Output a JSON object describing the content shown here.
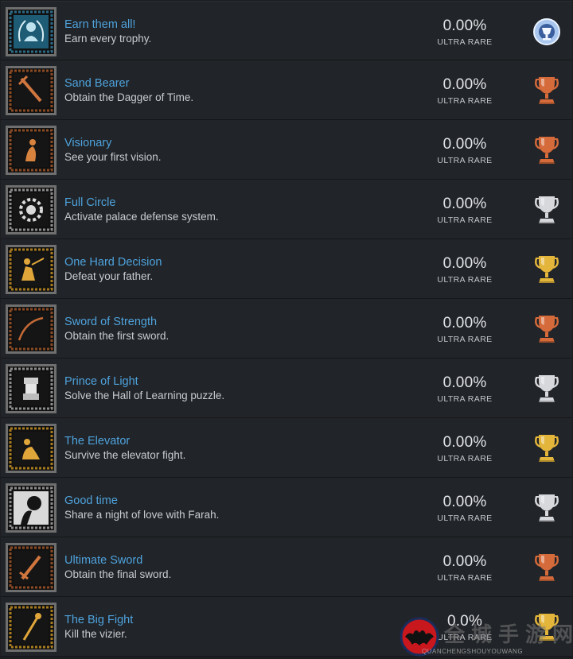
{
  "trophies": [
    {
      "title": "Earn them all!",
      "description": "Earn every trophy.",
      "percent": "0.00%",
      "rarity": "ULTRA RARE",
      "grade": "platinum",
      "art": "laurel-bust-art",
      "tint": "#2c6a86"
    },
    {
      "title": "Sand Bearer",
      "description": "Obtain the Dagger of Time.",
      "percent": "0.00%",
      "rarity": "ULTRA RARE",
      "grade": "bronze",
      "art": "dagger-art",
      "tint": "#8a4a23"
    },
    {
      "title": "Visionary",
      "description": "See your first vision.",
      "percent": "0.00%",
      "rarity": "ULTRA RARE",
      "grade": "bronze",
      "art": "kneeling-figure-art",
      "tint": "#8a4a23"
    },
    {
      "title": "Full Circle",
      "description": "Activate palace defense system.",
      "percent": "0.00%",
      "rarity": "ULTRA RARE",
      "grade": "silver",
      "art": "gear-circle-art",
      "tint": "#8c8c8c"
    },
    {
      "title": "One Hard Decision",
      "description": "Defeat your father.",
      "percent": "0.00%",
      "rarity": "ULTRA RARE",
      "grade": "gold",
      "art": "duel-art",
      "tint": "#a87b1f"
    },
    {
      "title": "Sword of Strength",
      "description": "Obtain the first sword.",
      "percent": "0.00%",
      "rarity": "ULTRA RARE",
      "grade": "bronze",
      "art": "curved-sword-art",
      "tint": "#8a4a23"
    },
    {
      "title": "Prince of Light",
      "description": "Solve the Hall of Learning puzzle.",
      "percent": "0.00%",
      "rarity": "ULTRA RARE",
      "grade": "silver",
      "art": "statue-art",
      "tint": "#8c8c8c"
    },
    {
      "title": "The Elevator",
      "description": "Survive the elevator fight.",
      "percent": "0.00%",
      "rarity": "ULTRA RARE",
      "grade": "gold",
      "art": "crouching-figure-art",
      "tint": "#a87b1f"
    },
    {
      "title": "Good time",
      "description": "Share a night of love with Farah.",
      "percent": "0.00%",
      "rarity": "ULTRA RARE",
      "grade": "silver",
      "art": "silhouette-pair-art",
      "tint": "#8c8c8c"
    },
    {
      "title": "Ultimate Sword",
      "description": "Obtain the final sword.",
      "percent": "0.00%",
      "rarity": "ULTRA RARE",
      "grade": "bronze",
      "art": "sword-art",
      "tint": "#8a4a23"
    },
    {
      "title": "The Big Fight",
      "description": "Kill the vizier.",
      "percent": "0.0%",
      "rarity": "ULTRA RARE",
      "grade": "gold",
      "art": "staff-art",
      "tint": "#a87b1f"
    }
  ],
  "colors": {
    "platinum": "#a9c6ee",
    "gold": "#e3b53b",
    "silver": "#d6d8dc",
    "bronze": "#d56a3a"
  },
  "watermark": {
    "text": "全城手游网",
    "subtext": "QUANCHENGSHOUYOUWANG",
    "logo_icon": "bat-logo-icon"
  }
}
